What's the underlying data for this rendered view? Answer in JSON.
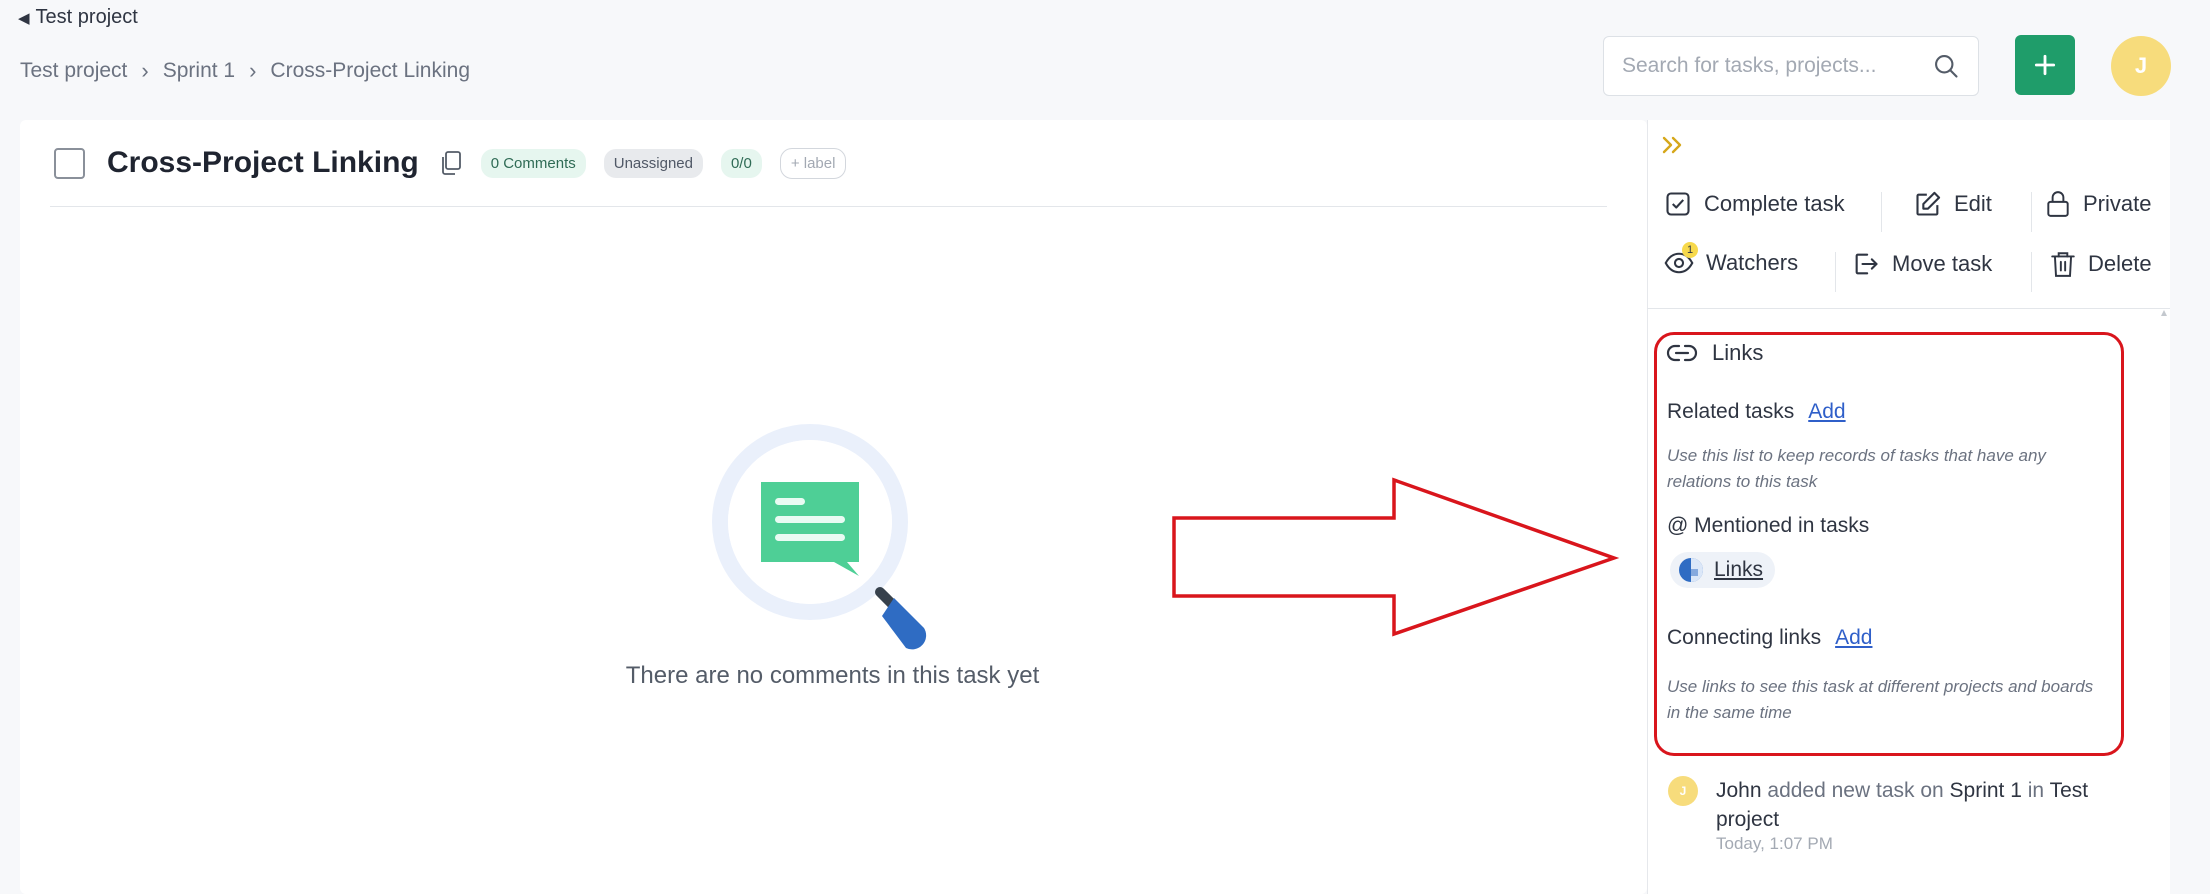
{
  "nav": {
    "back_label": "Test project",
    "breadcrumb": [
      "Test project",
      "Sprint 1",
      "Cross-Project Linking"
    ]
  },
  "header": {
    "search_placeholder": "Search for tasks, projects...",
    "avatar_initial": "J"
  },
  "task": {
    "title": "Cross-Project Linking",
    "comments_badge": "0 Comments",
    "assignee_badge": "Unassigned",
    "progress_badge": "0/0",
    "label_badge": "+ label",
    "empty_comments_text": "There are no comments in this task yet"
  },
  "actions": {
    "complete": "Complete task",
    "edit": "Edit",
    "private": "Private",
    "watchers": "Watchers",
    "watchers_count": "1",
    "move": "Move task",
    "delete": "Delete"
  },
  "links": {
    "title": "Links",
    "related_label": "Related tasks",
    "related_add": "Add",
    "related_hint": "Use this list to keep records of tasks that have any relations to this task",
    "mentioned_label": "@ Mentioned in tasks",
    "mentioned_chip": "Links",
    "connecting_label": "Connecting links",
    "connecting_add": "Add",
    "connecting_hint": "Use links to see this task at different projects and boards in the same time"
  },
  "activity": {
    "avatar_initial": "J",
    "user": "John",
    "action": "added new task on",
    "sprint": "Sprint 1",
    "preposition": "in",
    "project": "Test project",
    "time": "Today, 1:07 PM"
  },
  "colors": {
    "accent_green": "#1f9d6a",
    "avatar_yellow": "#f7dc7c",
    "link_blue": "#2f5fc9",
    "highlight_red": "#d9151c"
  }
}
